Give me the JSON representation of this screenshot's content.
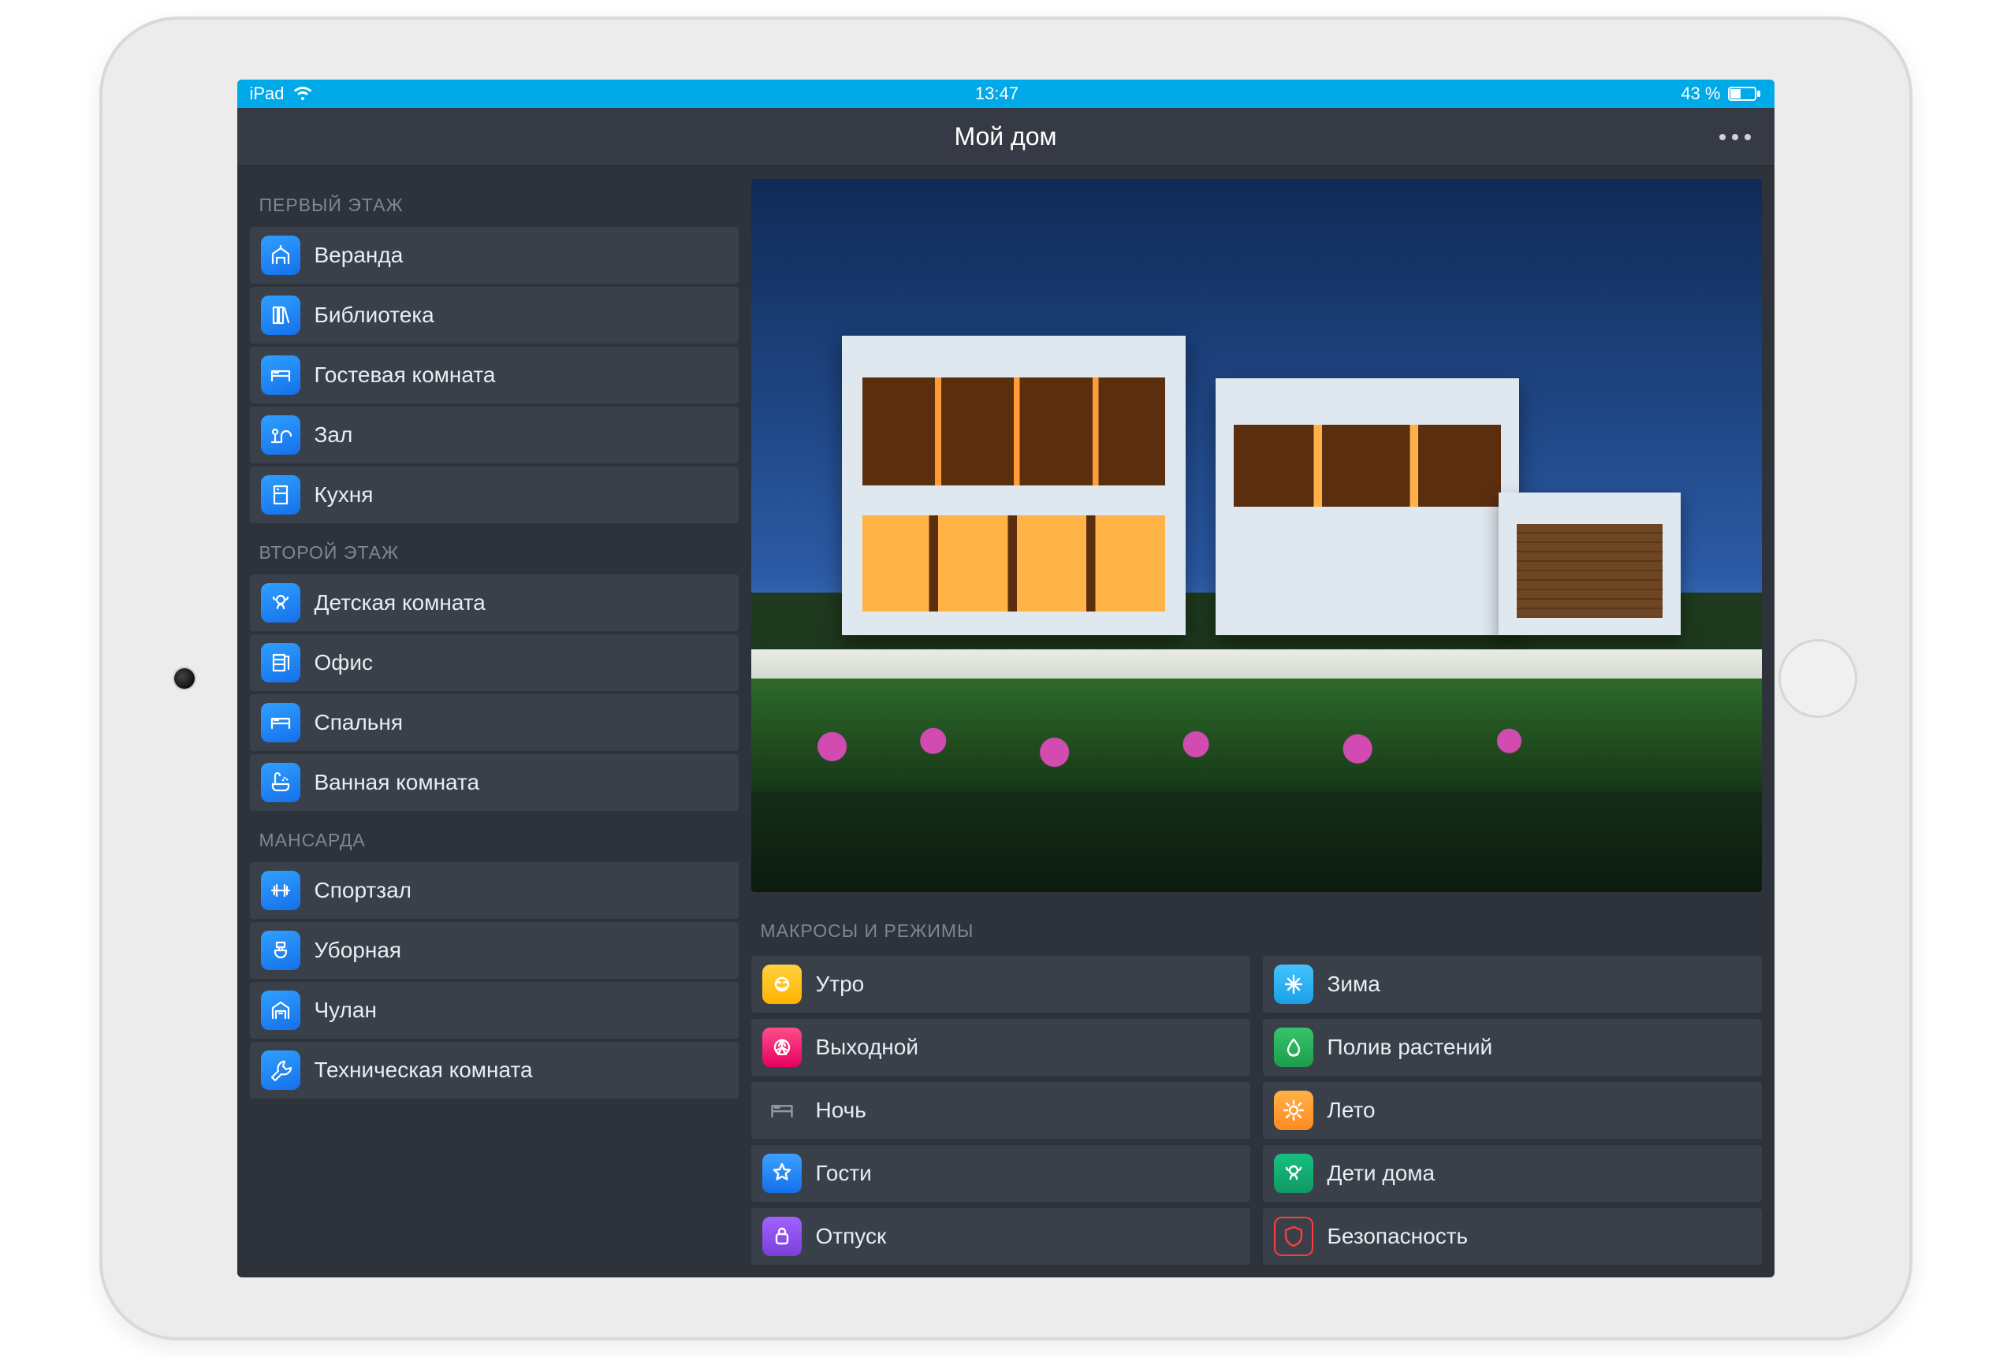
{
  "status": {
    "device": "iPad",
    "time": "13:47",
    "battery_text": "43 %"
  },
  "header": {
    "title": "Мой дом"
  },
  "sidebar": {
    "sections": [
      {
        "title": "ПЕРВЫЙ ЭТАЖ",
        "rooms": [
          {
            "label": "Веранда",
            "icon": "veranda-icon"
          },
          {
            "label": "Библиотека",
            "icon": "library-icon"
          },
          {
            "label": "Гостевая комната",
            "icon": "guest-room-icon"
          },
          {
            "label": "Зал",
            "icon": "living-room-icon"
          },
          {
            "label": "Кухня",
            "icon": "kitchen-icon"
          }
        ]
      },
      {
        "title": "ВТОРОЙ ЭТАЖ",
        "rooms": [
          {
            "label": "Детская комната",
            "icon": "kids-room-icon"
          },
          {
            "label": "Офис",
            "icon": "office-icon"
          },
          {
            "label": "Спальня",
            "icon": "bedroom-icon"
          },
          {
            "label": "Ванная комната",
            "icon": "bathroom-icon"
          }
        ]
      },
      {
        "title": "МАНСАРДА",
        "rooms": [
          {
            "label": "Спортзал",
            "icon": "gym-icon"
          },
          {
            "label": "Уборная",
            "icon": "restroom-icon"
          },
          {
            "label": "Чулан",
            "icon": "storage-icon"
          },
          {
            "label": "Техническая комната",
            "icon": "utility-icon"
          }
        ]
      }
    ]
  },
  "macros": {
    "title": "МАКРОСЫ И РЕЖИМЫ",
    "columns": [
      [
        {
          "label": "Утро",
          "icon": "morning-icon",
          "color": "c-yellow"
        },
        {
          "label": "Выходной",
          "icon": "weekend-icon",
          "color": "c-pink"
        },
        {
          "label": "Ночь",
          "icon": "night-icon",
          "color": "plain"
        },
        {
          "label": "Гости",
          "icon": "guests-icon",
          "color": "c-blue"
        },
        {
          "label": "Отпуск",
          "icon": "vacation-icon",
          "color": "c-purple"
        }
      ],
      [
        {
          "label": "Зима",
          "icon": "winter-icon",
          "color": "c-lblue"
        },
        {
          "label": "Полив растений",
          "icon": "watering-icon",
          "color": "c-green"
        },
        {
          "label": "Лето",
          "icon": "summer-icon",
          "color": "c-orange"
        },
        {
          "label": "Дети дома",
          "icon": "kids-home-icon",
          "color": "c-teal"
        },
        {
          "label": "Безопасность",
          "icon": "security-icon",
          "color": "c-redout"
        }
      ]
    ]
  }
}
